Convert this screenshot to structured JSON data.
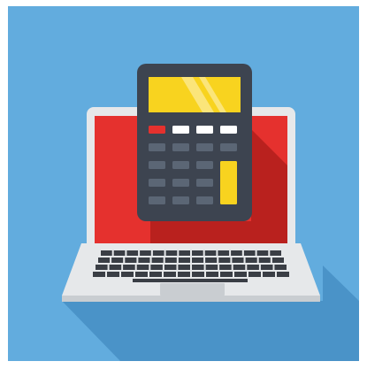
{
  "illustration": {
    "subject": "laptop-with-calculator",
    "colors": {
      "background": "#62ACDE",
      "long_shadow": "#4A93C8",
      "laptop_body": "#E6E8EA",
      "laptop_body_shade": "#C9CDD1",
      "laptop_screen": "#E5312E",
      "screen_shadow": "#B9211E",
      "keyboard_key": "#3A3E45",
      "touchpad": "#C9CDD1",
      "calculator_body": "#3D4450",
      "calculator_display": "#F8D31F",
      "calculator_display_glare": "#FBE57A",
      "calculator_key": "#5B6675",
      "calculator_key_white": "#FFFFFF",
      "calculator_key_red": "#E5312E",
      "calculator_key_yellow": "#F8D31F"
    }
  }
}
